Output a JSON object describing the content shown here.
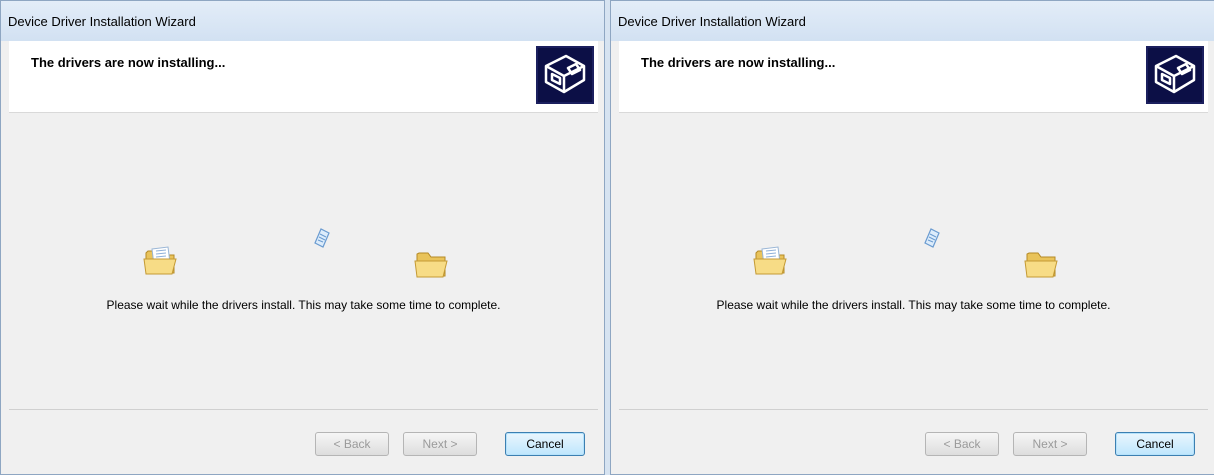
{
  "wizards": [
    {
      "title": "Device Driver Installation Wizard",
      "header_title": "The drivers are now installing...",
      "status_text": "Please wait while the drivers install. This may take some time to complete.",
      "buttons": {
        "back": "< Back",
        "next": "Next >",
        "cancel": "Cancel"
      },
      "icons": {
        "logo": "driver-hardware-icon",
        "source": "open-folder-icon",
        "destination": "folder-icon",
        "flying": "paper-icon"
      }
    },
    {
      "title": "Device Driver Installation Wizard",
      "header_title": "The drivers are now installing...",
      "status_text": "Please wait while the drivers install. This may take some time to complete.",
      "buttons": {
        "back": "< Back",
        "next": "Next >",
        "cancel": "Cancel"
      },
      "icons": {
        "logo": "driver-hardware-icon",
        "source": "open-folder-icon",
        "destination": "folder-icon",
        "flying": "paper-icon"
      }
    }
  ]
}
